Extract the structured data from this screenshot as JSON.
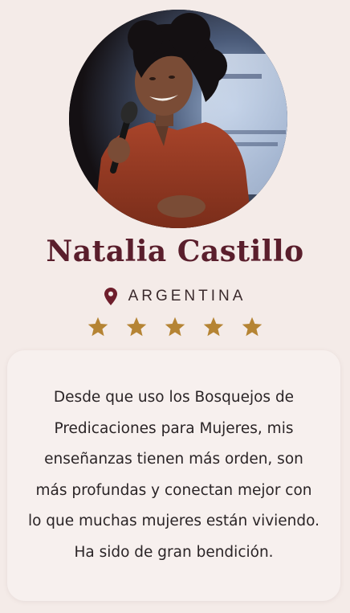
{
  "testimonial": {
    "name": "Natalia Castillo",
    "country": "ARGENTINA",
    "rating": 5,
    "rating_max": 5,
    "quote_lines": [
      "Desde que uso los Bosquejos de",
      "Predicaciones para Mujeres, mis",
      "enseñanzas tienen más orden, son",
      "más profundas y conectan mejor con",
      "lo que muchas mujeres están viviendo.",
      "Ha sido de gran bendición."
    ]
  },
  "icons": {
    "location": "map-pin-icon",
    "rating": "star-icon",
    "photo": "speaker-with-microphone-photo"
  },
  "colors": {
    "background": "#f4ebe8",
    "card": "#f7f0ee",
    "name": "#5a1e2c",
    "pin": "#6e1e2c",
    "star": "#b58434",
    "text": "#2a2426"
  }
}
